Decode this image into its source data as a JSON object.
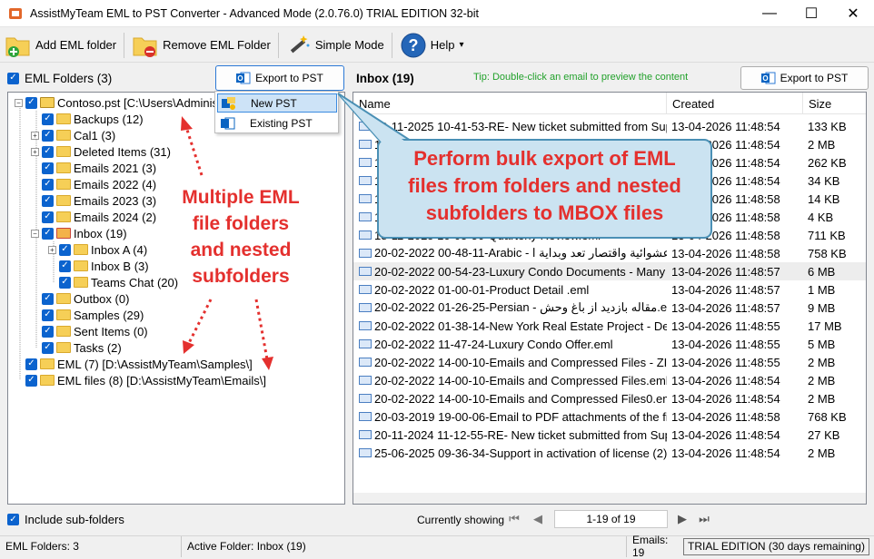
{
  "window": {
    "title": "AssistMyTeam EML to PST Converter - Advanced Mode (2.0.76.0) TRIAL EDITION 32-bit",
    "minimize": "—",
    "maximize": "☐",
    "close": "✕"
  },
  "toolbar": {
    "add_folder": "Add EML folder",
    "remove_folder": "Remove EML Folder",
    "simple_mode": "Simple Mode",
    "help": "Help",
    "help_arrow": "▾"
  },
  "left_panel": {
    "title": "EML Folders (3)",
    "export_button": "Export to PST",
    "include_subfolders": "Include sub-folders",
    "export_menu": [
      "New PST",
      "Existing PST"
    ]
  },
  "tree": [
    {
      "label": "Contoso.pst [C:\\Users\\Administrator\\Documents\\]",
      "level": 0,
      "expander": "−",
      "pst": true
    },
    {
      "label": "Backups (12)",
      "level": 1,
      "expander": ""
    },
    {
      "label": "Cal1 (3)",
      "level": 1,
      "expander": "+"
    },
    {
      "label": "Deleted Items (31)",
      "level": 1,
      "expander": "+"
    },
    {
      "label": "Emails 2021 (3)",
      "level": 1,
      "expander": ""
    },
    {
      "label": "Emails 2022 (4)",
      "level": 1,
      "expander": ""
    },
    {
      "label": "Emails 2023 (3)",
      "level": 1,
      "expander": ""
    },
    {
      "label": "Emails 2024 (2)",
      "level": 1,
      "expander": ""
    },
    {
      "label": "Inbox (19)",
      "level": 1,
      "expander": "−",
      "special": true
    },
    {
      "label": "Inbox A (4)",
      "level": 2,
      "expander": "+"
    },
    {
      "label": "Inbox B (3)",
      "level": 2,
      "expander": ""
    },
    {
      "label": "Teams Chat (20)",
      "level": 2,
      "expander": ""
    },
    {
      "label": "Outbox (0)",
      "level": 1,
      "expander": ""
    },
    {
      "label": "Samples (29)",
      "level": 1,
      "expander": ""
    },
    {
      "label": "Sent Items (0)",
      "level": 1,
      "expander": ""
    },
    {
      "label": "Tasks (2)",
      "level": 1,
      "expander": ""
    },
    {
      "label": "EML (7) [D:\\AssistMyTeam\\Samples\\]",
      "level": 0,
      "expander": ""
    },
    {
      "label": "EML files (8) [D:\\AssistMyTeam\\Emails\\]",
      "level": 0,
      "expander": ""
    }
  ],
  "right_panel": {
    "title": "Inbox (19)",
    "tip": "Tip: Double-click an email to preview the content",
    "export_button": "Export to PST",
    "columns": [
      "Name",
      "Created",
      "Size"
    ]
  },
  "emails": [
    {
      "name": "09-11-2025 10-41-53-RE- New ticket submitted from Support Portal.eml",
      "created": "13-04-2026 11:48:54",
      "size": "133 KB"
    },
    {
      "name": "10-11-2025 11-02-15-Re- Sales Report.eml",
      "created": "13-04-2026 11:48:54",
      "size": "2 MB"
    },
    {
      "name": "12-11-2025 09-33-04-Meeting Notes.eml",
      "created": "13-04-2026 11:48:54",
      "size": "262 KB"
    },
    {
      "name": "14-11-2025 16-20-41-Weekly Update.eml",
      "created": "13-04-2026 11:48:54",
      "size": "34 KB"
    },
    {
      "name": "15-11-2025 08-12-09-Project Proposal.eml",
      "created": "13-04-2026 11:48:58",
      "size": "14 KB"
    },
    {
      "name": "16-11-2025 13-45-27-Invoice.eml",
      "created": "13-04-2026 11:48:58",
      "size": "4 KB"
    },
    {
      "name": "18-11-2025 10-05-50-Quarterly Review.eml",
      "created": "13-04-2026 11:48:58",
      "size": "711 KB"
    },
    {
      "name": "20-02-2022 00-48-11-Arabic - عشوائية واقتصار تعد وبداية ا.eml",
      "created": "13-04-2026 11:48:58",
      "size": "758 KB"
    },
    {
      "name": "20-02-2022 00-54-23-Luxury Condo Documents - Many Attachments.eml",
      "created": "13-04-2026 11:48:57",
      "size": "6 MB"
    },
    {
      "name": "20-02-2022 01-00-01-Product Detail .eml",
      "created": "13-04-2026 11:48:57",
      "size": "1 MB"
    },
    {
      "name": "20-02-2022 01-26-25-Persian - مقاله بازدید از باغ وحش.eml",
      "created": "13-04-2026 11:48:57",
      "size": "9 MB"
    },
    {
      "name": "20-02-2022 01-38-14-New York Real Estate Project - Details.eml",
      "created": "13-04-2026 11:48:55",
      "size": "17 MB"
    },
    {
      "name": "20-02-2022 11-47-24-Luxury Condo Offer.eml",
      "created": "13-04-2026 11:48:55",
      "size": "5 MB"
    },
    {
      "name": "20-02-2022 14-00-10-Emails and Compressed Files - ZIP.eml",
      "created": "13-04-2026 11:48:55",
      "size": "2 MB"
    },
    {
      "name": "20-02-2022 14-00-10-Emails and Compressed Files.eml",
      "created": "13-04-2026 11:48:54",
      "size": "2 MB"
    },
    {
      "name": "20-02-2022 14-00-10-Emails and Compressed Files0.eml",
      "created": "13-04-2026 11:48:54",
      "size": "2 MB"
    },
    {
      "name": "20-03-2019 19-00-06-Email to PDF attachments of the files.eml",
      "created": "13-04-2026 11:48:58",
      "size": "768 KB"
    },
    {
      "name": "20-11-2024 11-12-55-RE- New ticket submitted from Support Portal.eml",
      "created": "13-04-2026 11:48:54",
      "size": "27 KB"
    },
    {
      "name": "25-06-2025 09-36-34-Support in activation of license (2).eml",
      "created": "13-04-2026 11:48:54",
      "size": "2 MB"
    }
  ],
  "nav": {
    "label": "Currently showing",
    "range": "1-19 of 19"
  },
  "annotations": {
    "left": [
      "Multiple EML",
      "file folders",
      "and nested",
      "subfolders"
    ],
    "callout": [
      "Perform bulk export of EML",
      "files from folders and nested",
      "subfolders to MBOX files"
    ]
  },
  "status": {
    "folders": "EML Folders: 3",
    "active": "Active Folder: Inbox (19)",
    "emails": "Emails: 19",
    "edition": "TRIAL EDITION (30 days remaining)"
  },
  "colors": {
    "accent": "#0b63ce",
    "annotation": "#e4302e",
    "tip": "#22a12b",
    "callout_fill": "#cbe3f1",
    "callout_border": "#4a90b5"
  }
}
